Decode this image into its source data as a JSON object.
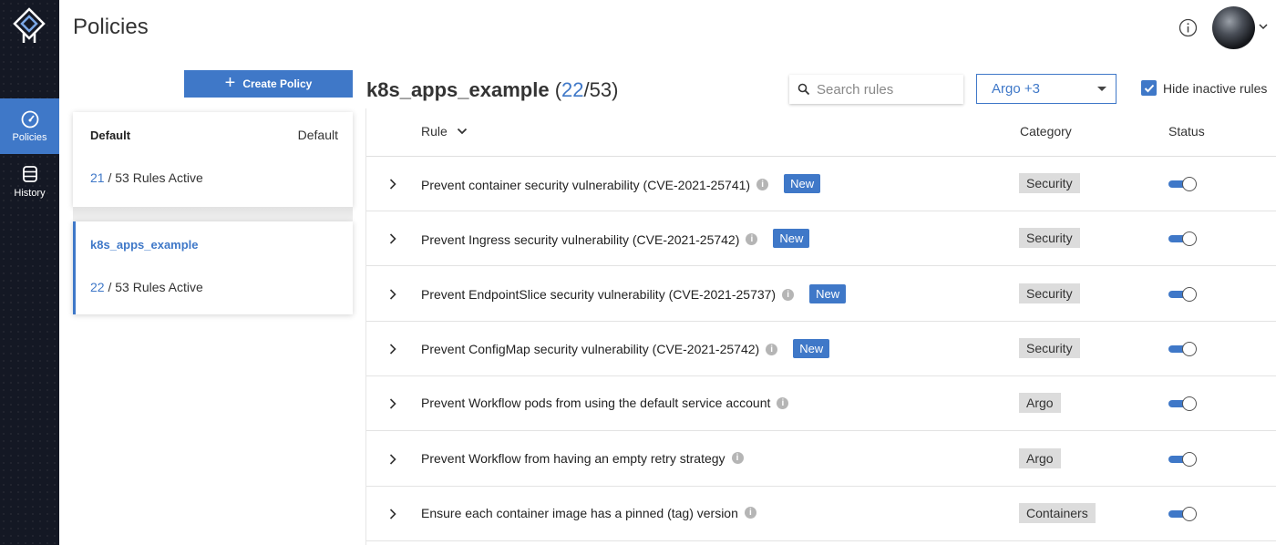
{
  "nav": {
    "items": [
      {
        "label": "Policies",
        "icon": "gauge-icon",
        "active": true
      },
      {
        "label": "History",
        "icon": "database-icon",
        "active": false
      }
    ]
  },
  "header": {
    "title": "Policies"
  },
  "sidebar": {
    "create_label": "Create Policy",
    "policies": [
      {
        "name": "Default",
        "tag": "Default",
        "active": "21",
        "sep": " / ",
        "rest": "53 Rules Active"
      },
      {
        "name": "k8s_apps_example",
        "tag": "",
        "active": "22",
        "sep": " / ",
        "rest": "53 Rules Active"
      }
    ]
  },
  "main": {
    "policy_name": "k8s_apps_example",
    "open_paren": "(",
    "active_count": "22",
    "slash_total": "/53",
    "close_paren": ")",
    "search_placeholder": "Search rules",
    "filter_value": "Argo +3",
    "hide_inactive_label": "Hide inactive rules"
  },
  "table": {
    "headers": {
      "rule": "Rule",
      "category": "Category",
      "status": "Status"
    },
    "new_label": "New",
    "rows": [
      {
        "name": "Prevent container security vulnerability (CVE-2021-25741)",
        "is_new": true,
        "category": "Security",
        "status_on": true
      },
      {
        "name": "Prevent Ingress security vulnerability (CVE-2021-25742)",
        "is_new": true,
        "category": "Security",
        "status_on": true
      },
      {
        "name": "Prevent EndpointSlice security vulnerability (CVE-2021-25737)",
        "is_new": true,
        "category": "Security",
        "status_on": true
      },
      {
        "name": "Prevent ConfigMap security vulnerability (CVE-2021-25742)",
        "is_new": true,
        "category": "Security",
        "status_on": true
      },
      {
        "name": "Prevent Workflow pods from using the default service account",
        "is_new": false,
        "category": "Argo",
        "status_on": true
      },
      {
        "name": "Prevent Workflow from having an empty retry strategy",
        "is_new": false,
        "category": "Argo",
        "status_on": true
      },
      {
        "name": "Ensure each container image has a pinned (tag) version",
        "is_new": false,
        "category": "Containers",
        "status_on": true
      }
    ]
  },
  "colors": {
    "accent": "#3f78c8",
    "rail": "#141824",
    "category_bg": "#dcdcdc"
  }
}
